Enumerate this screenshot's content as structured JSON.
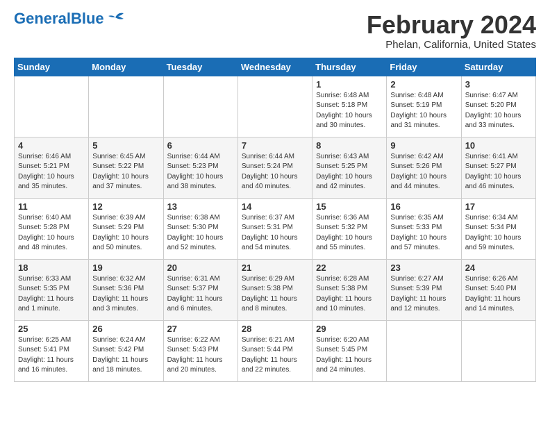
{
  "header": {
    "logo_general": "General",
    "logo_blue": "Blue",
    "month_title": "February 2024",
    "location": "Phelan, California, United States"
  },
  "days_of_week": [
    "Sunday",
    "Monday",
    "Tuesday",
    "Wednesday",
    "Thursday",
    "Friday",
    "Saturday"
  ],
  "weeks": [
    [
      {
        "day": "",
        "info": ""
      },
      {
        "day": "",
        "info": ""
      },
      {
        "day": "",
        "info": ""
      },
      {
        "day": "",
        "info": ""
      },
      {
        "day": "1",
        "info": "Sunrise: 6:48 AM\nSunset: 5:18 PM\nDaylight: 10 hours\nand 30 minutes."
      },
      {
        "day": "2",
        "info": "Sunrise: 6:48 AM\nSunset: 5:19 PM\nDaylight: 10 hours\nand 31 minutes."
      },
      {
        "day": "3",
        "info": "Sunrise: 6:47 AM\nSunset: 5:20 PM\nDaylight: 10 hours\nand 33 minutes."
      }
    ],
    [
      {
        "day": "4",
        "info": "Sunrise: 6:46 AM\nSunset: 5:21 PM\nDaylight: 10 hours\nand 35 minutes."
      },
      {
        "day": "5",
        "info": "Sunrise: 6:45 AM\nSunset: 5:22 PM\nDaylight: 10 hours\nand 37 minutes."
      },
      {
        "day": "6",
        "info": "Sunrise: 6:44 AM\nSunset: 5:23 PM\nDaylight: 10 hours\nand 38 minutes."
      },
      {
        "day": "7",
        "info": "Sunrise: 6:44 AM\nSunset: 5:24 PM\nDaylight: 10 hours\nand 40 minutes."
      },
      {
        "day": "8",
        "info": "Sunrise: 6:43 AM\nSunset: 5:25 PM\nDaylight: 10 hours\nand 42 minutes."
      },
      {
        "day": "9",
        "info": "Sunrise: 6:42 AM\nSunset: 5:26 PM\nDaylight: 10 hours\nand 44 minutes."
      },
      {
        "day": "10",
        "info": "Sunrise: 6:41 AM\nSunset: 5:27 PM\nDaylight: 10 hours\nand 46 minutes."
      }
    ],
    [
      {
        "day": "11",
        "info": "Sunrise: 6:40 AM\nSunset: 5:28 PM\nDaylight: 10 hours\nand 48 minutes."
      },
      {
        "day": "12",
        "info": "Sunrise: 6:39 AM\nSunset: 5:29 PM\nDaylight: 10 hours\nand 50 minutes."
      },
      {
        "day": "13",
        "info": "Sunrise: 6:38 AM\nSunset: 5:30 PM\nDaylight: 10 hours\nand 52 minutes."
      },
      {
        "day": "14",
        "info": "Sunrise: 6:37 AM\nSunset: 5:31 PM\nDaylight: 10 hours\nand 54 minutes."
      },
      {
        "day": "15",
        "info": "Sunrise: 6:36 AM\nSunset: 5:32 PM\nDaylight: 10 hours\nand 55 minutes."
      },
      {
        "day": "16",
        "info": "Sunrise: 6:35 AM\nSunset: 5:33 PM\nDaylight: 10 hours\nand 57 minutes."
      },
      {
        "day": "17",
        "info": "Sunrise: 6:34 AM\nSunset: 5:34 PM\nDaylight: 10 hours\nand 59 minutes."
      }
    ],
    [
      {
        "day": "18",
        "info": "Sunrise: 6:33 AM\nSunset: 5:35 PM\nDaylight: 11 hours\nand 1 minute."
      },
      {
        "day": "19",
        "info": "Sunrise: 6:32 AM\nSunset: 5:36 PM\nDaylight: 11 hours\nand 3 minutes."
      },
      {
        "day": "20",
        "info": "Sunrise: 6:31 AM\nSunset: 5:37 PM\nDaylight: 11 hours\nand 6 minutes."
      },
      {
        "day": "21",
        "info": "Sunrise: 6:29 AM\nSunset: 5:38 PM\nDaylight: 11 hours\nand 8 minutes."
      },
      {
        "day": "22",
        "info": "Sunrise: 6:28 AM\nSunset: 5:38 PM\nDaylight: 11 hours\nand 10 minutes."
      },
      {
        "day": "23",
        "info": "Sunrise: 6:27 AM\nSunset: 5:39 PM\nDaylight: 11 hours\nand 12 minutes."
      },
      {
        "day": "24",
        "info": "Sunrise: 6:26 AM\nSunset: 5:40 PM\nDaylight: 11 hours\nand 14 minutes."
      }
    ],
    [
      {
        "day": "25",
        "info": "Sunrise: 6:25 AM\nSunset: 5:41 PM\nDaylight: 11 hours\nand 16 minutes."
      },
      {
        "day": "26",
        "info": "Sunrise: 6:24 AM\nSunset: 5:42 PM\nDaylight: 11 hours\nand 18 minutes."
      },
      {
        "day": "27",
        "info": "Sunrise: 6:22 AM\nSunset: 5:43 PM\nDaylight: 11 hours\nand 20 minutes."
      },
      {
        "day": "28",
        "info": "Sunrise: 6:21 AM\nSunset: 5:44 PM\nDaylight: 11 hours\nand 22 minutes."
      },
      {
        "day": "29",
        "info": "Sunrise: 6:20 AM\nSunset: 5:45 PM\nDaylight: 11 hours\nand 24 minutes."
      },
      {
        "day": "",
        "info": ""
      },
      {
        "day": "",
        "info": ""
      }
    ]
  ]
}
